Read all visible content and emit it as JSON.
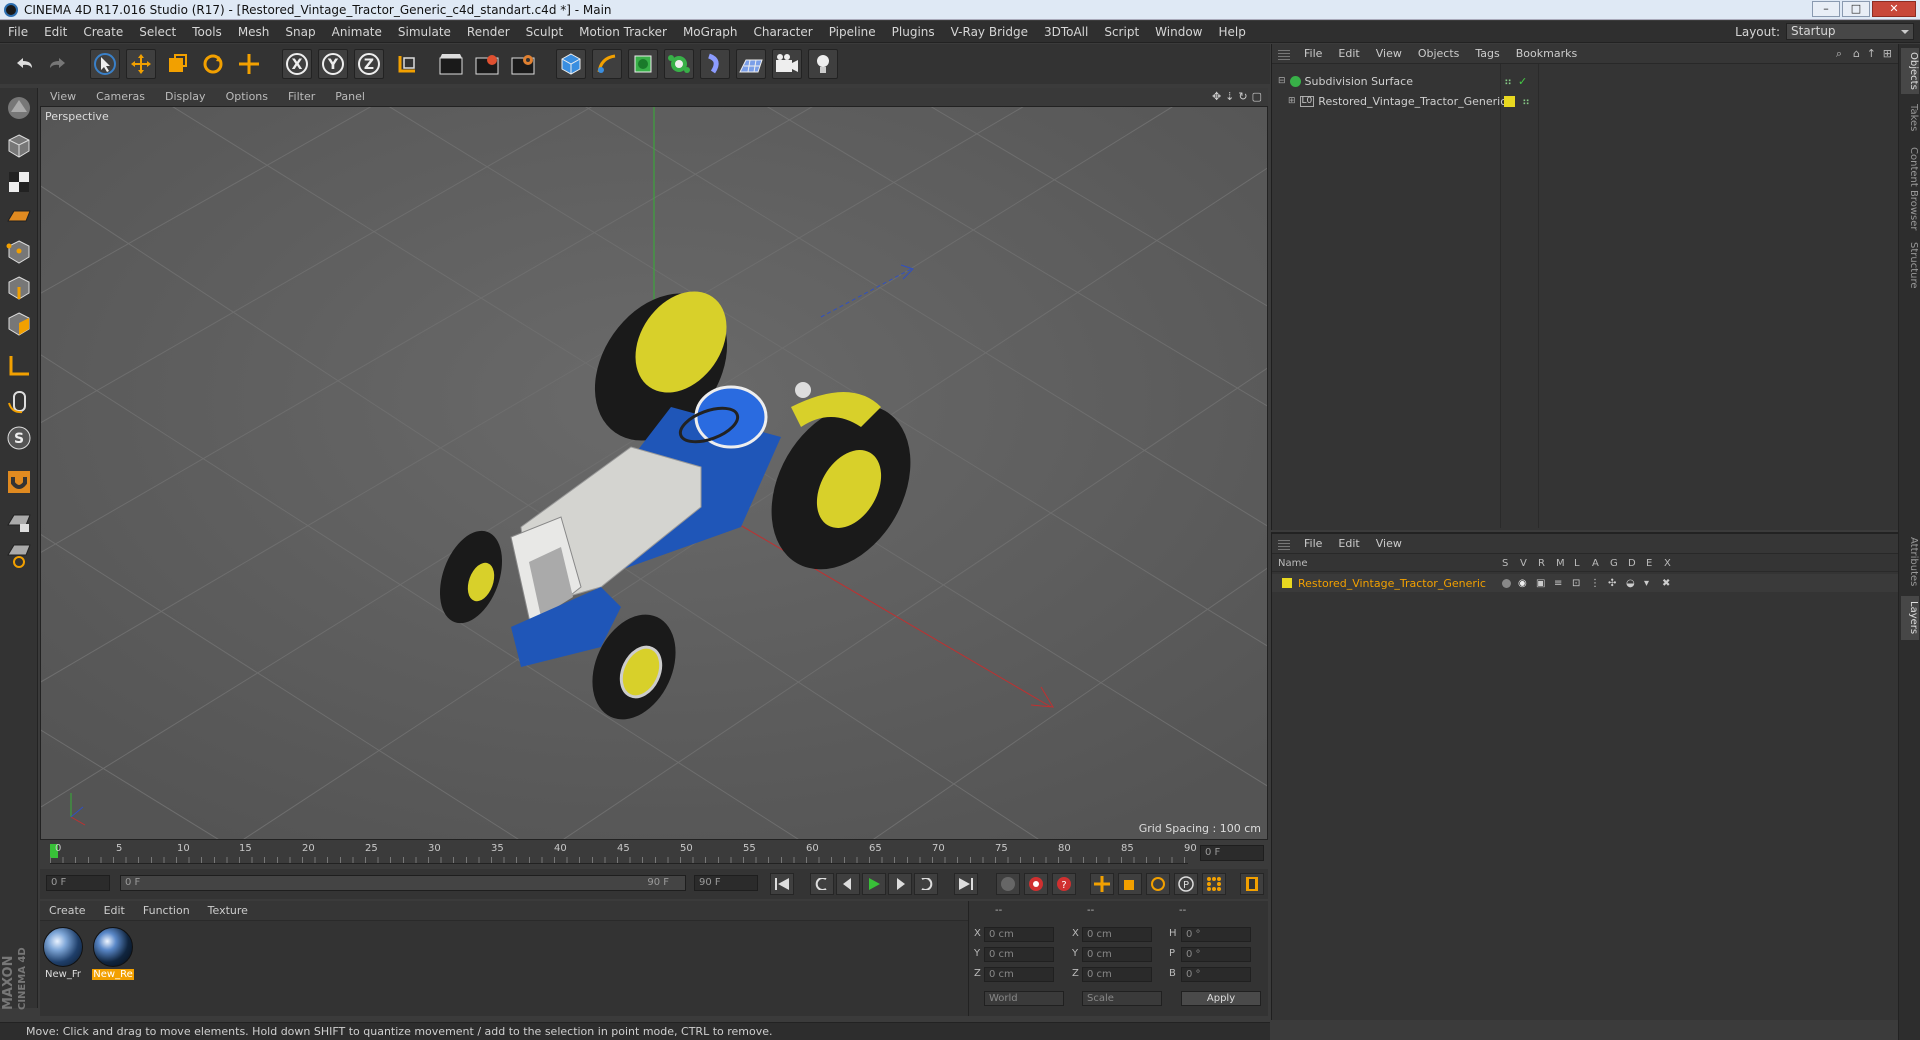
{
  "window": {
    "title": "CINEMA 4D R17.016 Studio (R17) - [Restored_Vintage_Tractor_Generic_c4d_standart.c4d *] - Main"
  },
  "menubar": {
    "items": [
      "File",
      "Edit",
      "Create",
      "Select",
      "Tools",
      "Mesh",
      "Snap",
      "Animate",
      "Simulate",
      "Render",
      "Sculpt",
      "Motion Tracker",
      "MoGraph",
      "Character",
      "Pipeline",
      "Plugins",
      "V-Ray Bridge",
      "3DToAll",
      "Script",
      "Window",
      "Help"
    ],
    "layout_label": "Layout:",
    "layout_value": "Startup"
  },
  "viewport": {
    "menu": [
      "View",
      "Cameras",
      "Display",
      "Options",
      "Filter",
      "Panel"
    ],
    "label": "Perspective",
    "grid_spacing": "Grid Spacing : 100 cm"
  },
  "timeline": {
    "ticks": [
      "0",
      "5",
      "10",
      "15",
      "20",
      "25",
      "30",
      "35",
      "40",
      "45",
      "50",
      "55",
      "60",
      "65",
      "70",
      "75",
      "80",
      "85",
      "90"
    ],
    "current_frame": "0 F"
  },
  "playbar": {
    "start": "0 F",
    "range_start": "0 F",
    "range_end": "90 F",
    "end": "90 F"
  },
  "materials": {
    "menu": [
      "Create",
      "Edit",
      "Function",
      "Texture"
    ],
    "items": [
      {
        "label": "New_Fr"
      },
      {
        "label": "New_Re"
      }
    ]
  },
  "coords": {
    "header": [
      "--",
      "--",
      "--"
    ],
    "rows": [
      {
        "a_label": "X",
        "a_val": "0 cm",
        "b_label": "X",
        "b_val": "0 cm",
        "c_label": "H",
        "c_val": "0 °"
      },
      {
        "a_label": "Y",
        "a_val": "0 cm",
        "b_label": "Y",
        "b_val": "0 cm",
        "c_label": "P",
        "c_val": "0 °"
      },
      {
        "a_label": "Z",
        "a_val": "0 cm",
        "b_label": "Z",
        "b_val": "0 cm",
        "c_label": "B",
        "c_val": "0 °"
      }
    ],
    "world": "World",
    "scale": "Scale",
    "apply": "Apply"
  },
  "objects": {
    "menu": [
      "File",
      "Edit",
      "View",
      "Objects",
      "Tags",
      "Bookmarks"
    ],
    "rows": [
      "Subdivision Surface",
      "Restored_Vintage_Tractor_Generic"
    ]
  },
  "layers": {
    "menu": [
      "File",
      "Edit",
      "View"
    ],
    "name_header": "Name",
    "columns": [
      "S",
      "V",
      "R",
      "M",
      "L",
      "A",
      "G",
      "D",
      "E",
      "X"
    ],
    "row": "Restored_Vintage_Tractor_Generic"
  },
  "right_tabs": [
    "Objects",
    "Takes",
    "Content Browser",
    "Structure",
    "Attributes",
    "Layers"
  ],
  "brand": {
    "line1": "MAXON",
    "line2": "CINEMA 4D"
  },
  "status": "Move: Click and drag to move elements. Hold down SHIFT to quantize movement / add to the selection in point mode, CTRL to remove.",
  "colors": {
    "accent": "#f2a000",
    "tractor_blue": "#1f56b8",
    "tractor_yellow": "#d8d02a",
    "selection": "#e8a020"
  }
}
